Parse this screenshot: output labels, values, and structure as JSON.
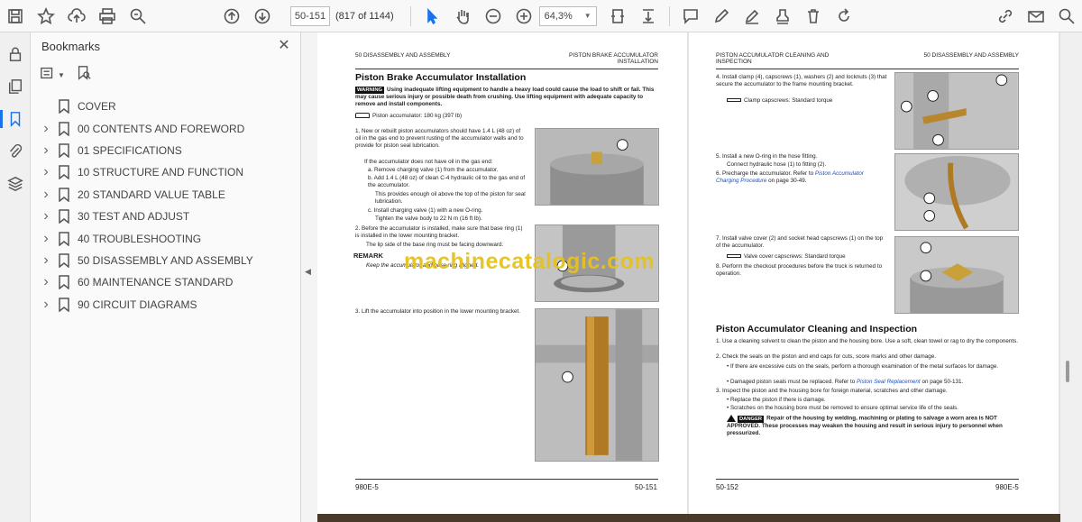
{
  "toolbar": {
    "page_current": "50-151",
    "page_of": "(817 of 1144)",
    "zoom": "64,3%"
  },
  "panel": {
    "title": "Bookmarks",
    "items": [
      {
        "label": "COVER",
        "expandable": false
      },
      {
        "label": "00 CONTENTS AND FOREWORD",
        "expandable": true
      },
      {
        "label": "01 SPECIFICATIONS",
        "expandable": true
      },
      {
        "label": "10 STRUCTURE AND FUNCTION",
        "expandable": true
      },
      {
        "label": "20 STANDARD VALUE TABLE",
        "expandable": true
      },
      {
        "label": "30 TEST AND ADJUST",
        "expandable": true
      },
      {
        "label": "40 TROUBLESHOOTING",
        "expandable": true
      },
      {
        "label": "50 DISASSEMBLY AND ASSEMBLY",
        "expandable": true
      },
      {
        "label": "60 MAINTENANCE STANDARD",
        "expandable": true
      },
      {
        "label": "90 CIRCUIT DIAGRAMS",
        "expandable": true
      }
    ]
  },
  "left_page": {
    "header_left": "50 DISASSEMBLY AND ASSEMBLY",
    "header_right_1": "PISTON BRAKE ACCUMULATOR",
    "header_right_2": "INSTALLATION",
    "title": "Piston Brake Accumulator Installation",
    "warning_tag": "WARNING",
    "warning_text": "Using inadequate lifting equipment to handle a heavy load could cause the load to shift or fail. This may cause serious injury or possible death from crushing. Use lifting equipment with adequate capacity to remove and install components.",
    "weight": "Piston accumulator: 180 kg (397 lb)",
    "step1": "1.   New or rebuilt piston accumulators should have 1.4 L (48 oz) of oil in the gas end to prevent rusting of the accumulator walls and to provide for piston seal lubrication.",
    "step1_if": "If the accumulator does not have oil in the gas end:",
    "step1_a": "a.   Remove charging valve (1) from the accumulator.",
    "step1_b": "b.   Add 1.4 L (48 oz) of clean C-4 hydraulic oil to the gas end of the accumulator.",
    "step1_note": "This provides enough oil above the top of the piston for seal lubrication.",
    "step1_c": "c.   Install charging valve (1) with a new O-ring.",
    "step1_torque": "Tighten the valve body to 22 N m (16 ft lb).",
    "step2": "2.   Before the accumulator is installed, make sure that base ring (1) is installed in the lower mounting bracket.",
    "step2_note": "The lip side of the base ring must be facing downward.",
    "remark_title": "REMARK",
    "remark_text": "Keep the accumulator and base ring aligned.",
    "step3": "3.   Lift the accumulator into position in the lower mounting bracket.",
    "footer_left": "980E-5",
    "footer_right": "50-151"
  },
  "right_page": {
    "header_left_1": "PISTON ACCUMULATOR CLEANING AND",
    "header_left_2": "INSPECTION",
    "header_right": "50 DISASSEMBLY AND ASSEMBLY",
    "step4": "4.   Install clamp (4), capscrews (1), washers (2) and locknuts (3) that secure the accumulator to the frame mounting bracket.",
    "step4_torque": "Clamp capscrews: Standard torque",
    "step5": "5.   Install a new O-ring in the hose fitting.",
    "step5_b": "Connect hydraulic hose (1) to fitting (2).",
    "step6_pre": "6.   Precharge the accumulator. Refer to",
    "step6_link": "Piston Accumulator Charging Procedure",
    "step6_post": "on page 30-49.",
    "step7": "7.   Install valve cover (2) and socket head capscrews (1) on the top of the accumulator.",
    "step7_torque": "Valve cover capscrews: Standard torque",
    "step8": "8.   Perform the checkout procedures before the truck is returned to operation.",
    "section_title": "Piston Accumulator Cleaning and Inspection",
    "c1": "1.   Use a cleaning solvent to clean the piston and the housing bore. Use a soft, clean towel or rag to dry the components.",
    "c2": "2.   Check the seals on the piston and end caps for cuts, score marks and other damage.",
    "c2_b1": "•   If there are excessive cuts on the seals, perform a thorough examination of the metal surfaces for damage.",
    "c2_b2_pre": "•   Damaged piston seals must be replaced. Refer to",
    "c2_b2_link": "Piston Seal Replacement",
    "c2_b2_post": "on page 50-131.",
    "c3": "3.   Inspect the piston and the housing bore for foreign material, scratches and other damage.",
    "c3_b1": "•   Replace the piston if there is damage.",
    "c3_b2": "•   Scratches on the housing bore must be removed to ensure optimal service life of the seals.",
    "danger_tag": "DANGER",
    "danger_text": "Repair of the housing by welding, machining or plating to salvage a worn area is NOT APPROVED. These processes may weaken the housing and result in serious injury to personnel when pressurized.",
    "footer_left": "50-152",
    "footer_right": "980E-5"
  },
  "watermark": "machinecatalogic.com",
  "colors": {
    "accent": "#1a73e8",
    "watermark": "#e6c21e"
  }
}
